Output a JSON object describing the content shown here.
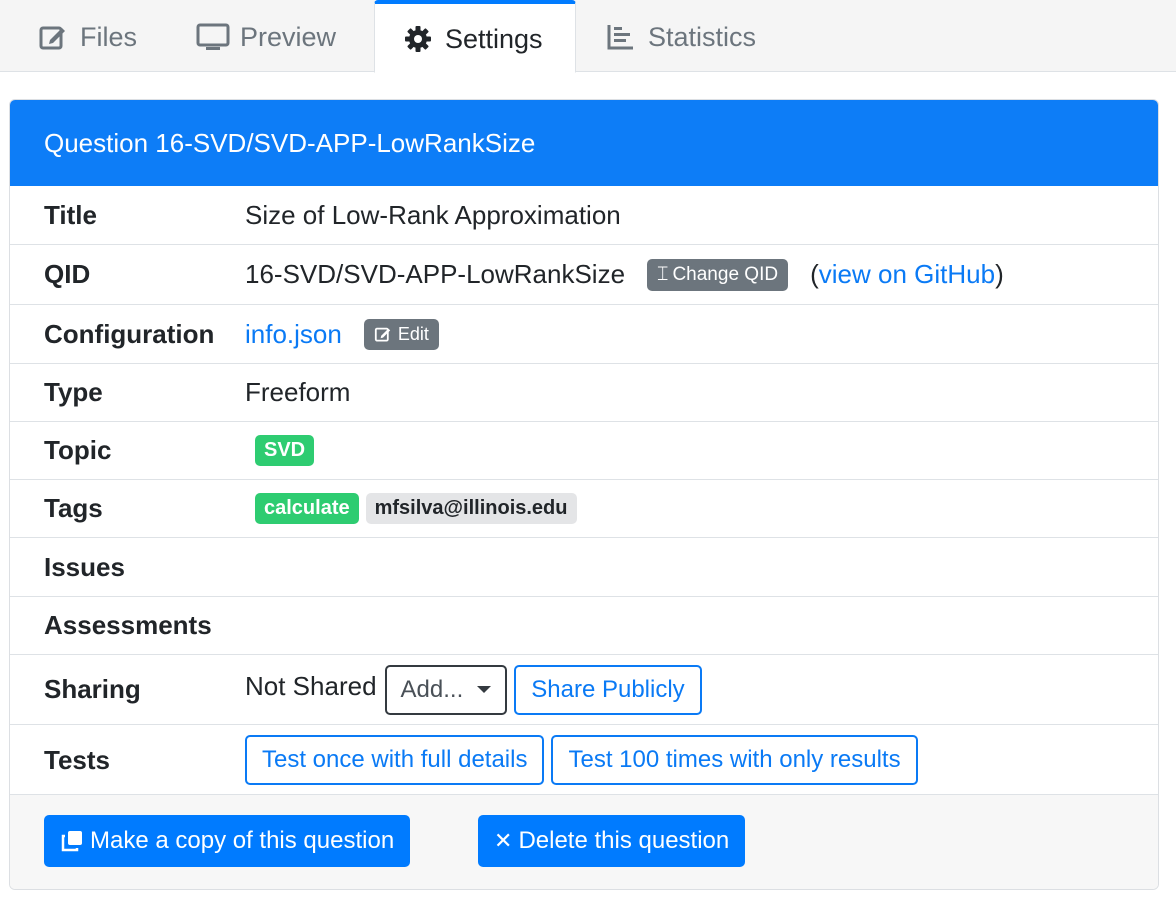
{
  "tabs": [
    {
      "label": "Files",
      "icon": "edit-icon"
    },
    {
      "label": "Preview",
      "icon": "monitor-icon"
    },
    {
      "label": "Settings",
      "icon": "gear-icon"
    },
    {
      "label": "Statistics",
      "icon": "bar-chart-icon"
    }
  ],
  "active_tab": "Settings",
  "card": {
    "header": "Question 16-SVD/SVD-APP-LowRankSize",
    "rows": {
      "title": {
        "label": "Title",
        "value": "Size of Low-Rank Approximation"
      },
      "qid": {
        "label": "QID",
        "value": "16-SVD/SVD-APP-LowRankSize",
        "change_label": "Change QID",
        "paren_open": "(",
        "github_link": "view on GitHub",
        "paren_close": ")"
      },
      "configuration": {
        "label": "Configuration",
        "file_link": "info.json",
        "edit_label": "Edit"
      },
      "type": {
        "label": "Type",
        "value": "Freeform"
      },
      "topic": {
        "label": "Topic",
        "badge": "SVD"
      },
      "tags": {
        "label": "Tags",
        "tag1": "calculate",
        "tag2": "mfsilva@illinois.edu"
      },
      "issues": {
        "label": "Issues"
      },
      "assessments": {
        "label": "Assessments"
      },
      "sharing": {
        "label": "Sharing",
        "status": "Not Shared",
        "select_value": "Add...",
        "share_button": "Share Publicly"
      },
      "tests": {
        "label": "Tests",
        "test_once": "Test once with full details",
        "test_100": "Test 100 times with only results"
      }
    },
    "footer": {
      "copy_button": "Make a copy of this question",
      "delete_button": "Delete this question"
    }
  },
  "colors": {
    "primary": "#007bff",
    "header": "#0d7df7",
    "success_badge": "#2ecc71",
    "secondary_badge": "#6c757d"
  }
}
